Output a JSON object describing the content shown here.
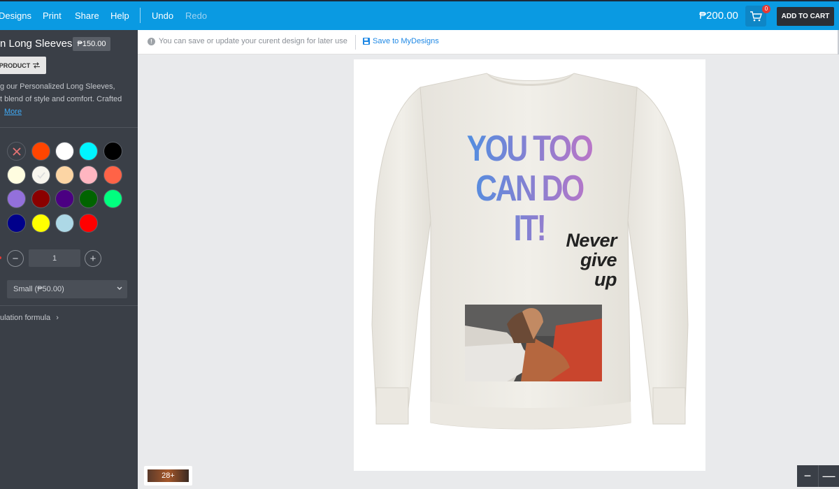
{
  "topbar": {
    "menu": [
      "Designs",
      "Print",
      "Share",
      "Help"
    ],
    "undo": "Undo",
    "redo": "Redo",
    "total": "₱200.00",
    "cart_count": "0",
    "add_to_cart": "ADD TO CART"
  },
  "sidebar": {
    "product_title": "n Long Sleeves",
    "product_price": "₱150.00",
    "product_button": "PRODUCT",
    "description": [
      "g our Personalized Long Sleeves,",
      "t blend of style and comfort. Crafted"
    ],
    "more_link": "More",
    "swatches": [
      "none",
      "#ff4500",
      "#ffffff",
      "#00f5ff",
      "#000000",
      "#fffde0",
      "#f7f5ee",
      "#fcd5a4",
      "#ffb6c1",
      "#ff6347",
      "#9370db",
      "#8b0000",
      "#4b0082",
      "#006400",
      "#00ff7f",
      "#00008b",
      "#ffff00",
      "#add8e6",
      "#ff0000"
    ],
    "quantity": "1",
    "size_selected": "Small (₱50.00)",
    "calc_link": "ulation formula"
  },
  "infobar": {
    "message": "You can save or update your curent design for later use",
    "save_link": "Save to MyDesigns"
  },
  "design": {
    "title": "YOU TOO CAN DO IT!",
    "subtitle_lines": [
      "Never",
      "give",
      "up"
    ]
  },
  "bottom": {
    "thumb_label": "28+",
    "zoom_out": "−",
    "zoom_in": "—"
  }
}
